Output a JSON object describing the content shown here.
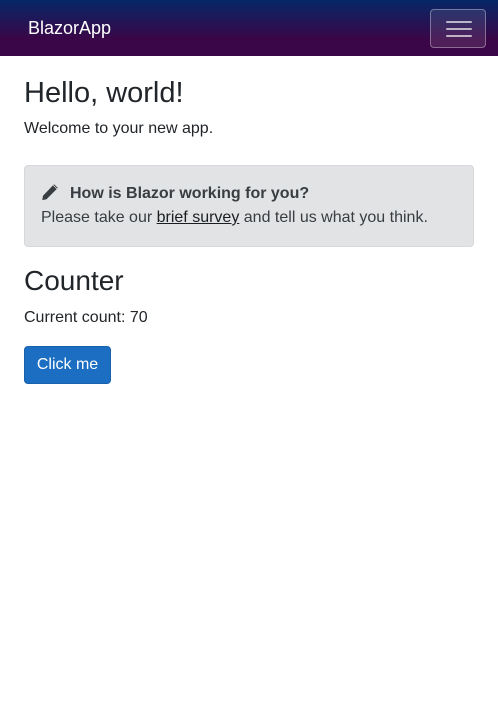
{
  "navbar": {
    "brand": "BlazorApp",
    "toggler_icon": "hamburger-menu-icon"
  },
  "main": {
    "heading": "Hello, world!",
    "welcome": "Welcome to your new app."
  },
  "survey": {
    "icon": "pencil-icon",
    "title": "How is Blazor working for you?",
    "text_before": "Please take our ",
    "link_text": "brief survey",
    "text_after": " and tell us what you think."
  },
  "counter": {
    "heading": "Counter",
    "count_label": "Current count: 70",
    "button_label": "Click me"
  },
  "colors": {
    "navbar_gradient_top": "#052767",
    "navbar_gradient_bottom": "#3a0647",
    "button": "#1b6ec2",
    "alert_background": "#e2e3e5"
  }
}
